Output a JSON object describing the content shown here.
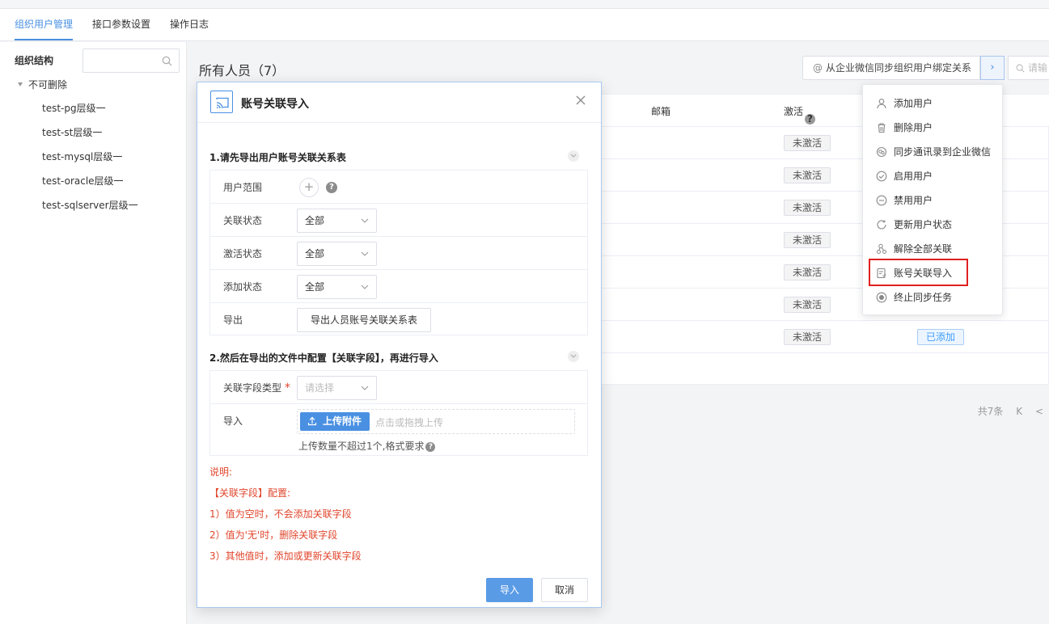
{
  "tabs": [
    {
      "label": "组织用户管理",
      "active": true
    },
    {
      "label": "接口参数设置",
      "active": false
    },
    {
      "label": "操作日志",
      "active": false
    }
  ],
  "sidebar": {
    "title": "组织结构",
    "search_placeholder": "",
    "root": "不可删除",
    "items": [
      "test-pg层级一",
      "test-st层级一",
      "test-mysql层级一",
      "test-oracle层级一",
      "test-sqlserver层级一"
    ]
  },
  "main": {
    "title": "所有人员（7）",
    "sync_button": "从企业微信同步组织用户绑定关系",
    "sync_prefix": "@",
    "arrow": "›",
    "search_placeholder": "请输",
    "columns": {
      "email": "邮箱",
      "active": "激活",
      "active_help": "?"
    },
    "rows": [
      {
        "active": "未激活",
        "added": ""
      },
      {
        "active": "未激活",
        "added": ""
      },
      {
        "active": "未激活",
        "added": ""
      },
      {
        "active": "未激活",
        "added": ""
      },
      {
        "active": "未激活",
        "added": ""
      },
      {
        "active": "未激活",
        "added": ""
      },
      {
        "active": "未激活",
        "added": "已添加"
      }
    ],
    "pager": {
      "total": "共7条",
      "first": "K",
      "prev": "<"
    }
  },
  "dropdown": {
    "items": [
      {
        "label": "添加用户",
        "icon": "user-icon"
      },
      {
        "label": "删除用户",
        "icon": "trash-icon"
      },
      {
        "label": "同步通讯录到企业微信",
        "icon": "sync-wechat-icon"
      },
      {
        "label": "启用用户",
        "icon": "check-circle-icon"
      },
      {
        "label": "禁用用户",
        "icon": "minus-circle-icon"
      },
      {
        "label": "更新用户状态",
        "icon": "refresh-icon"
      },
      {
        "label": "解除全部关联",
        "icon": "unlink-icon"
      },
      {
        "label": "账号关联导入",
        "icon": "import-icon"
      },
      {
        "label": "终止同步任务",
        "icon": "stop-icon"
      }
    ]
  },
  "modal": {
    "title": "账号关联导入",
    "section1": {
      "title": "1.请先导出用户账号关联关系表",
      "scope_label": "用户范围",
      "plus": "+",
      "help": "?",
      "link_status_label": "关联状态",
      "link_status_value": "全部",
      "active_status_label": "激活状态",
      "active_status_value": "全部",
      "add_status_label": "添加状态",
      "add_status_value": "全部",
      "export_label": "导出",
      "export_button": "导出人员账号关联关系表"
    },
    "section2": {
      "title": "2.然后在导出的文件中配置【关联字段】，再进行导入",
      "field_type_label": "关联字段类型",
      "required_mark": "*",
      "field_type_placeholder": "请选择",
      "import_label": "导入",
      "upload_button": "上传附件",
      "upload_hint": "点击或拖拽上传",
      "upload_note": "上传数量不超过1个,格式要求",
      "upload_note_help": "?"
    },
    "notes": [
      "说明:",
      "【关联字段】配置:",
      "1）值为空时，不会添加关联字段",
      "2）值为'无'时，删除关联字段",
      "3）其他值时，添加或更新关联字段"
    ],
    "ok_button": "导入",
    "cancel_button": "取消"
  }
}
